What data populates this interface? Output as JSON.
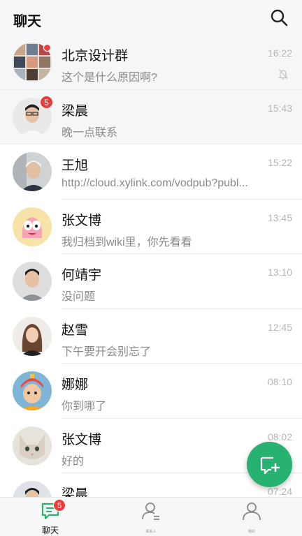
{
  "header": {
    "title": "聊天",
    "search_icon": "search-icon"
  },
  "chats": [
    {
      "name": "北京设计群",
      "preview": "这个是什么原因啊?",
      "time": "16:22",
      "pinned": true,
      "dot": true,
      "muted": true
    },
    {
      "name": "梁晨",
      "preview": "晚一点联系",
      "time": "15:43",
      "pinned": true,
      "badge": "5"
    },
    {
      "name": "王旭",
      "preview": "http://cloud.xylink.com/vodpub?publ...",
      "time": "15:22"
    },
    {
      "name": "张文博",
      "preview": "我归档到wiki里，你先看看",
      "time": "13:45"
    },
    {
      "name": "何靖宇",
      "preview": "没问题",
      "time": "13:10"
    },
    {
      "name": "赵雪",
      "preview": "下午要开会别忘了",
      "time": "12:45"
    },
    {
      "name": "娜娜",
      "preview": "你到哪了",
      "time": "08:10"
    },
    {
      "name": "张文博",
      "preview": "好的",
      "time": "08:02"
    },
    {
      "name": "梁晨",
      "preview": "",
      "time": "07:24"
    }
  ],
  "tabs": [
    {
      "label": "聊天",
      "badge": "5",
      "active": true
    },
    {
      "label": "联系人"
    },
    {
      "label": "我的"
    }
  ],
  "colors": {
    "accent": "#27b272",
    "badge": "#ec3a3a"
  }
}
